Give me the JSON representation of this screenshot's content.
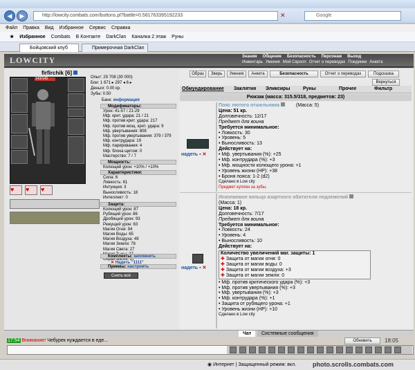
{
  "browser": {
    "url": "http://lowcity.combats.com/buttons.pl?battle=0.581763395192233",
    "search_placeholder": "Google",
    "menu": [
      "Файл",
      "Правка",
      "Вид",
      "Избранное",
      "Сервис",
      "Справка"
    ],
    "favorites": [
      "Избранное",
      "Combats",
      "В Контакте",
      "DarkClan",
      "Каналка 2 этаж",
      "Руны"
    ],
    "tabs": [
      "Бойцовский клуб",
      "Примерочная DarkClan"
    ]
  },
  "game": {
    "logo": "LOWCITY",
    "top_menu": [
      "Знания",
      "Общение",
      "Безопасность",
      "Персонаж",
      "Выход"
    ],
    "sub_menu": [
      "Инвентарь",
      "Умения",
      "Мой Скролл",
      "Отчет о переводах",
      "Поединки",
      "Анкета"
    ],
    "char_name": "firfirchik",
    "char_level": "[6]",
    "hp": "143/143",
    "stats_top": [
      "Опыт: 29 708 (30 000)",
      "Бои: 1 671 ▸ 297 ◂ 6 ▸",
      "Деньги: 0.00 кр.",
      "Зубы: 0.50"
    ],
    "bank_label": "Банк:",
    "bank_link": "информация",
    "sections": {
      "modifiers": "Модификаторы:",
      "power": "Мощность:",
      "characteristics": "Характеристики:",
      "protection": "Защита:",
      "techniques": "Приемы:",
      "complects": "Комплекты:",
      "buttons": "Кнопки:"
    },
    "modifiers": [
      "Урон: 41-57 / 21-29",
      "Мф. крит. удара: 21 / 21",
      "Мф. против крит. удара: 217",
      "Мф. против мощ. крит. удара: 9",
      "Мф. увертывания: 808",
      "Мф. против увертывания: 379 / 379",
      "Мф. контрудара: 19",
      "Мф. парирования: 4",
      "Мф. блока щитом: 0",
      "Мастерство: 7 / 7"
    ],
    "power": [
      "Колющий урон: +10% / +10%"
    ],
    "characteristics": [
      "Сила: 6",
      "Ловкость: 61",
      "Интуиция: 3",
      "Выносливость: 18",
      "Интеллект: 0"
    ],
    "protection": [
      "Колющий урон: 87",
      "Рубящий урон: 86",
      "Дробящий урон: 93",
      "Режущий урон: 63",
      "Магия Огня: 94",
      "Магия Воды: 65",
      "Магия Воздуха: 49",
      "Магия Земли: 78",
      "Магия Света: 27",
      "Магия Тьмы: 27",
      "Серая магия: 27"
    ],
    "techniques_link": "настроить",
    "complects_link": "запомнить",
    "complect_item": "Надеть \"1111\"",
    "remove_all": "Снять всё",
    "buttons": [
      "Образ",
      "Зверь",
      "Умения",
      "Анкета",
      "Безопасность",
      "Отчет о переводах",
      "Подсказка"
    ],
    "return_btn": "Вернуться",
    "inv_tabs": [
      "Обмундирование",
      "Заклятия",
      "Эликсиры",
      "Руны",
      "Прочее",
      "Фильтр"
    ],
    "inv_title": "Рюкзак (масса: 315.5/318, предметов: 23)",
    "items": [
      {
        "name": "Пояс лютого отшельника",
        "mass": "(Масса: 5)",
        "lines": [
          "Цена: 51 кр.",
          "Долговечность: 12/17",
          "Предмет для воина",
          "Требуется минимальное:",
          "• Ловкость: 30",
          "• Уровень: 5",
          "• Выносливость: 13",
          "Действует на:",
          "• Мф. увертывания (%): +25",
          "• Мф. контрудара (%): +3",
          "• Мф. мощности колющего урона: +1",
          "• Уровень жизни (HP): +38",
          "• Броня пояса: 1-2 (d2)",
          "Сделано в Low city"
        ],
        "warn": "Предмет куплен за зубы.",
        "wear": "надеть"
      },
      {
        "name": "Ископаемое кольцо азартного обитателя подземелий",
        "mass": "(Масса: 1)",
        "lines": [
          "Цена: 18 кр.",
          "Долговечность: 7/17",
          "Предмет для воина",
          "Требуется минимальное:",
          "• Ловкость: 24",
          "• Уровень: 4",
          "• Выносливость: 10",
          "Действует на:"
        ],
        "upgrades_title": "Количество увеличений маг. защиты: 1",
        "upgrades": [
          "Защита от магии огня: 0",
          "Защита от магии воды: 0",
          "Защита от магии воздуха: +3",
          "Защита от магии земли: 0"
        ],
        "lines2": [
          "• Мф. против критического удара (%): +3",
          "• Мф. против увертывания (%): +3",
          "• Мф. увертывания (%): +3",
          "• Мф. контрудара (%): +1",
          "• Защита от рубящего урона: +1",
          "• Уровень жизни (HP): +10",
          "Сделано в Low city"
        ],
        "wear": "надеть"
      }
    ],
    "chat_tabs": [
      "Чат",
      "Системные сообщения"
    ],
    "chat_time": "17:54",
    "chat_warning": "Внимание!",
    "chat_message": "Чебурек нуждается в еде...",
    "refresh": "Обновить",
    "clock": "18:05",
    "status": "Интернет | Защищенный режим: вкл."
  },
  "watermark": "photo.scrolls.combats.com"
}
